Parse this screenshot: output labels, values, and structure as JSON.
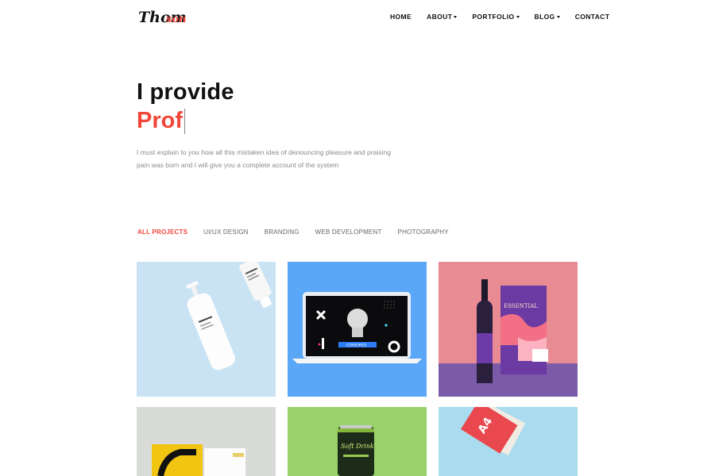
{
  "brand": {
    "logo_text": "Thomson"
  },
  "nav": {
    "items": [
      {
        "label": "HOME",
        "dropdown": false
      },
      {
        "label": "ABOUT",
        "dropdown": true
      },
      {
        "label": "PORTFOLIO",
        "dropdown": true
      },
      {
        "label": "BLOG",
        "dropdown": true
      },
      {
        "label": "CONTACT",
        "dropdown": false
      }
    ]
  },
  "hero": {
    "line1": "I provide",
    "line2_typed": "Prof",
    "description": "I must explain to you how all this mistaken idea of denouncing pleasure and praising pain was born and I will give you a complete account of the system"
  },
  "filters": [
    {
      "label": "ALL PROJECTS",
      "active": true
    },
    {
      "label": "UI/UX DESIGN",
      "active": false
    },
    {
      "label": "BRANDING",
      "active": false
    },
    {
      "label": "WEB DEVELOPMENT",
      "active": false
    },
    {
      "label": "PHOTOGRAPHY",
      "active": false
    }
  ],
  "portfolio": {
    "items": [
      {
        "subject": "cosmetic-bottles",
        "background": "#c9e3f4"
      },
      {
        "subject": "laptop-mockup",
        "background": "#5ba7f7",
        "screen_label": "CENSORED"
      },
      {
        "subject": "wine-packaging",
        "background": "#e98b92",
        "label": "ESSENTIAL"
      },
      {
        "subject": "brochure-yellow",
        "background": "#d9dbd8"
      },
      {
        "subject": "soda-can",
        "background": "#9bd16b",
        "label": "Soft Drink"
      },
      {
        "subject": "a4-brochure",
        "background": "#a9dcef",
        "label": "A4"
      }
    ]
  },
  "colors": {
    "accent": "#f0473a",
    "text": "#111111",
    "muted": "#8b8b8b"
  }
}
